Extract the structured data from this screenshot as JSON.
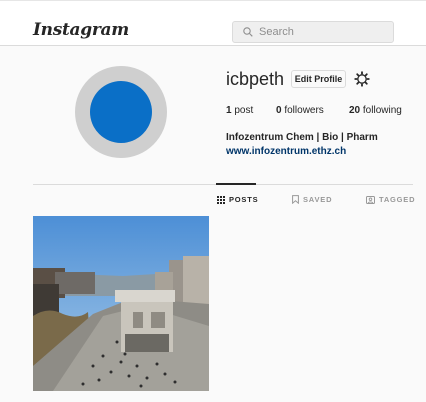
{
  "header": {
    "logo": "Instagram",
    "search_placeholder": "Search"
  },
  "profile": {
    "username": "icbpeth",
    "edit_label": "Edit Profile",
    "posts_count": "1",
    "posts_label": "post",
    "followers_count": "0",
    "followers_label": "followers",
    "following_count": "20",
    "following_label": "following",
    "full_name": "Infozentrum Chem | Bio | Pharm",
    "website": "www.infozentrum.ethz.ch",
    "avatar_color": "#0a6fc7"
  },
  "tabs": [
    {
      "label": "POSTS",
      "icon": "grid-icon",
      "active": true
    },
    {
      "label": "SAVED",
      "icon": "bookmark-icon",
      "active": false
    },
    {
      "label": "TAGGED",
      "icon": "tag-icon",
      "active": false
    }
  ],
  "posts": [
    {
      "description_icon": "campus-photo"
    }
  ]
}
